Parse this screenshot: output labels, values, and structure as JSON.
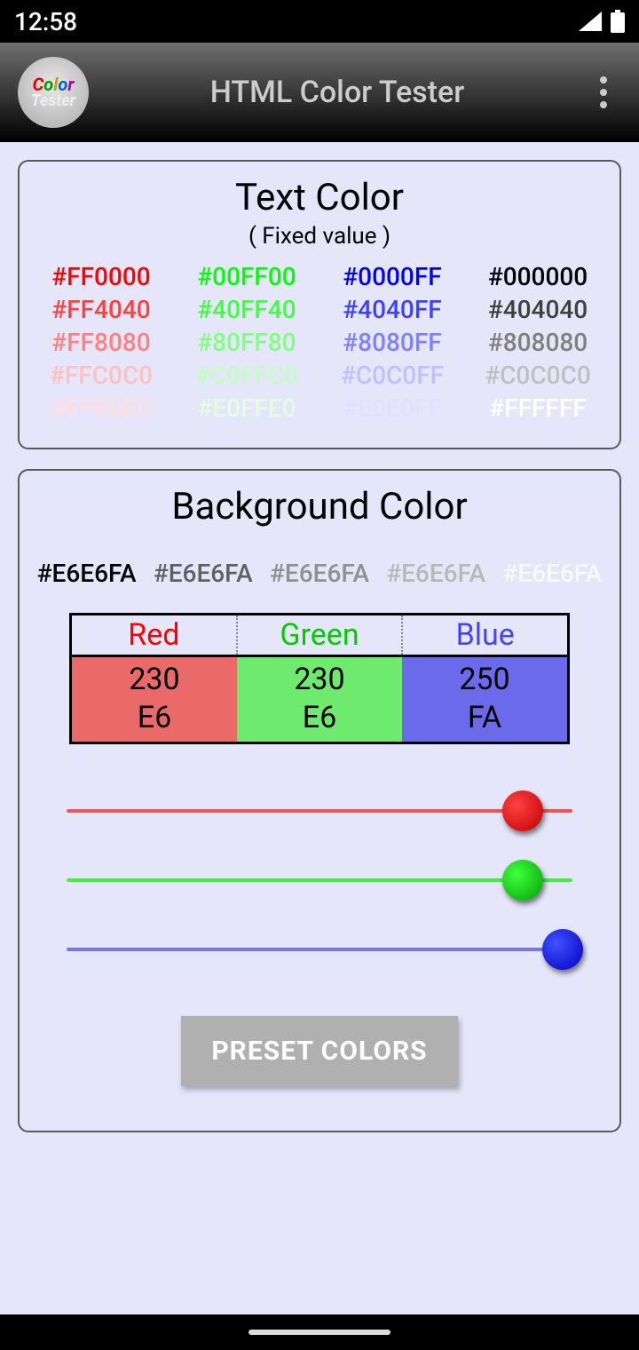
{
  "status": {
    "time": "12:58"
  },
  "header": {
    "title": "HTML Color Tester"
  },
  "textColor": {
    "title": "Text Color",
    "subtitle": "( Fixed value )",
    "grid": [
      {
        "label": "#FF0000",
        "color": "#FF0000"
      },
      {
        "label": "#00FF00",
        "color": "#00FF00"
      },
      {
        "label": "#0000FF",
        "color": "#0000FF"
      },
      {
        "label": "#000000",
        "color": "#000000"
      },
      {
        "label": "#FF4040",
        "color": "#FF4040"
      },
      {
        "label": "#40FF40",
        "color": "#40FF40"
      },
      {
        "label": "#4040FF",
        "color": "#4040FF"
      },
      {
        "label": "#404040",
        "color": "#404040"
      },
      {
        "label": "#FF8080",
        "color": "#FF8080"
      },
      {
        "label": "#80FF80",
        "color": "#80FF80"
      },
      {
        "label": "#8080FF",
        "color": "#8080FF"
      },
      {
        "label": "#808080",
        "color": "#808080"
      },
      {
        "label": "#FFC0C0",
        "color": "#FFC0C0"
      },
      {
        "label": "#C0FFC0",
        "color": "#C0FFC0"
      },
      {
        "label": "#C0C0FF",
        "color": "#C0C0FF"
      },
      {
        "label": "#C0C0C0",
        "color": "#C0C0C0"
      },
      {
        "label": "#FFE0E0",
        "color": "#FFE0E0"
      },
      {
        "label": "#E0FFE0",
        "color": "#E0FFE0"
      },
      {
        "label": "#E0E0FF",
        "color": "#E0E0FF"
      },
      {
        "label": "#FFFFFF",
        "color": "#FFFFFF"
      }
    ]
  },
  "bgColor": {
    "title": "Background Color",
    "hexRow": [
      {
        "label": "#E6E6FA",
        "shade": "#000000"
      },
      {
        "label": "#E6E6FA",
        "shade": "#606060"
      },
      {
        "label": "#E6E6FA",
        "shade": "#909090"
      },
      {
        "label": "#E6E6FA",
        "shade": "#B8B8B8"
      },
      {
        "label": "#E6E6FA",
        "shade": "#F8F8FE"
      }
    ],
    "channels": {
      "red": {
        "name": "Red",
        "dec": "230",
        "hex": "E6",
        "value": 230
      },
      "green": {
        "name": "Green",
        "dec": "230",
        "hex": "E6",
        "value": 230
      },
      "blue": {
        "name": "Blue",
        "dec": "250",
        "hex": "FA",
        "value": 250
      }
    },
    "presetLabel": "PRESET COLORS"
  }
}
